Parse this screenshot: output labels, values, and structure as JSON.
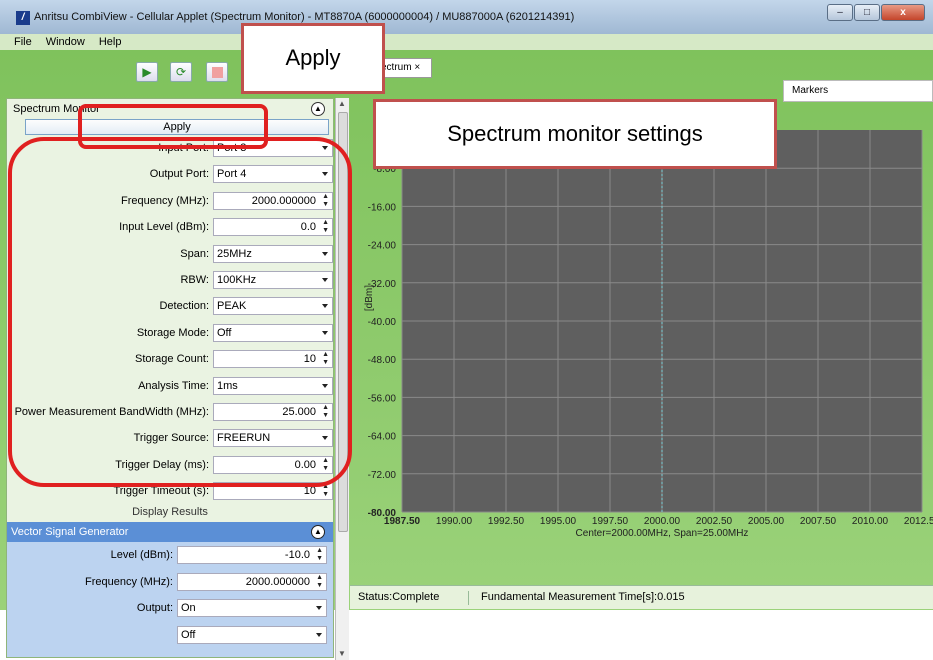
{
  "window": {
    "title": "Anritsu CombiView - Cellular Applet (Spectrum Monitor) - MT8870A (6000000004) / MU887000A (6201214391)",
    "app_icon": "anritsu-logo-icon",
    "minimize": "–",
    "maximize": "□",
    "close": "x"
  },
  "menu": [
    "File",
    "Window",
    "Help"
  ],
  "toolbar": {
    "play_icon": "play-icon",
    "loop_icon": "loop-icon",
    "stop_icon": "stop-icon"
  },
  "spectrum_monitor": {
    "header": "Spectrum Monitor",
    "apply_label": "Apply",
    "fields": [
      {
        "label": "Input Port:",
        "value": "Port 3",
        "type": "select"
      },
      {
        "label": "Output Port:",
        "value": "Port 4",
        "type": "select"
      },
      {
        "label": "Frequency (MHz):",
        "value": "2000.000000",
        "type": "number"
      },
      {
        "label": "Input Level (dBm):",
        "value": "0.0",
        "type": "number"
      },
      {
        "label": "Span:",
        "value": "25MHz",
        "type": "select"
      },
      {
        "label": "RBW:",
        "value": "100KHz",
        "type": "select"
      },
      {
        "label": "Detection:",
        "value": "PEAK",
        "type": "select"
      },
      {
        "label": "Storage Mode:",
        "value": "Off",
        "type": "select"
      },
      {
        "label": "Storage Count:",
        "value": "10",
        "type": "number"
      },
      {
        "label": "Analysis Time:",
        "value": "1ms",
        "type": "select"
      },
      {
        "label": "Power Measurement BandWidth (MHz):",
        "value": "25.000",
        "type": "number"
      },
      {
        "label": "Trigger Source:",
        "value": "FREERUN",
        "type": "select"
      },
      {
        "label": "Trigger Delay (ms):",
        "value": "0.00",
        "type": "number"
      },
      {
        "label": "Trigger Timeout (s):",
        "value": "10",
        "type": "number"
      }
    ],
    "display_results": "Display Results"
  },
  "vsg": {
    "header": "Vector Signal Generator",
    "fields": [
      {
        "label": "Level (dBm):",
        "value": "-10.0",
        "type": "number"
      },
      {
        "label": "Frequency (MHz):",
        "value": "2000.000000",
        "type": "number"
      },
      {
        "label": "Output:",
        "value": "On",
        "type": "select"
      },
      {
        "label": "",
        "value": "Off",
        "type": "select"
      }
    ]
  },
  "tab": {
    "label": "ectrum",
    "close": "×"
  },
  "markers_label": "Markers",
  "status": {
    "state": "Status:Complete",
    "time": "Fundamental Measurement Time[s]:0.015"
  },
  "callouts": {
    "apply": "Apply",
    "settings": "Spectrum monitor settings"
  },
  "colors": {
    "plot_bg": "#5f5f5f",
    "grid": "#8a8a8a",
    "marker_line": "#7fd0d8",
    "callout_border": "#c0504d",
    "highlight": "#e02020"
  },
  "chart_data": {
    "type": "line",
    "ylabel": "[dBm]",
    "y_ticks": [
      "-8.00",
      "-16.00",
      "-24.00",
      "-32.00",
      "-40.00",
      "-48.00",
      "-56.00",
      "-64.00",
      "-72.00",
      "-80.00"
    ],
    "x_ticks": [
      "1987.50",
      "1990.00",
      "1992.50",
      "1995.00",
      "1997.50",
      "2000.00",
      "2002.50",
      "2005.00",
      "2007.50",
      "2010.00",
      "2012.50"
    ],
    "xlim": [
      1987.5,
      2012.5
    ],
    "ylim": [
      -80,
      0
    ],
    "center_marker": 2000.0,
    "footer": "Center=2000.00MHz, Span=25.00MHz",
    "grid": true
  }
}
